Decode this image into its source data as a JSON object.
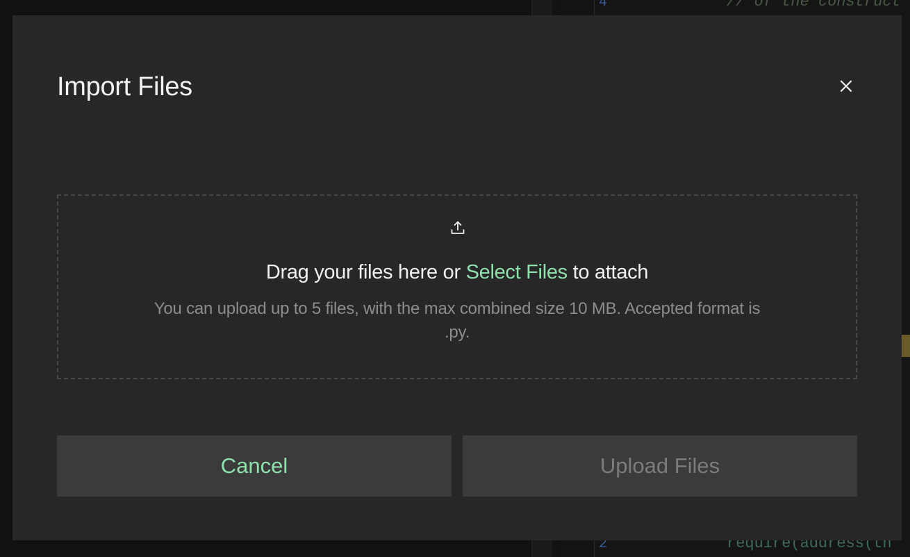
{
  "modal": {
    "title": "Import Files",
    "close_icon": "close-icon",
    "dropzone": {
      "icon": "upload-icon",
      "drag_prefix": "Drag your files here or ",
      "select_link": "Select Files",
      "drag_suffix": " to attach",
      "hint": "You can upload up to 5 files, with the max combined size 10 MB. Accepted format is .py."
    },
    "buttons": {
      "cancel": "Cancel",
      "upload": "Upload Files"
    }
  },
  "background_editor": {
    "lines": [
      {
        "number": "4",
        "text": "// of the construct",
        "kind": "comment"
      },
      {
        "number": "2",
        "text": "require(address(th",
        "kind": "code"
      }
    ]
  },
  "colors": {
    "modal_bg": "#272727",
    "accent": "#8fe0ac",
    "button_bg": "#3b3b3b",
    "muted_text": "#8d8d8d",
    "disabled_text": "#7c7c7c"
  }
}
